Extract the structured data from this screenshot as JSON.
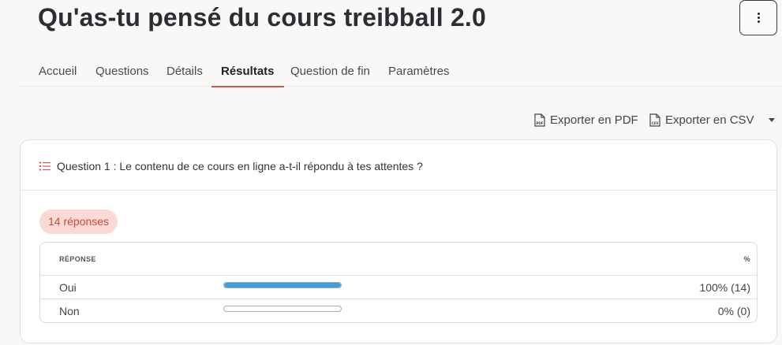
{
  "page": {
    "title": "Qu'as-tu pensé du cours treibball 2.0"
  },
  "tabs": [
    {
      "label": "Accueil",
      "active": false
    },
    {
      "label": "Questions",
      "active": false
    },
    {
      "label": "Détails",
      "active": false
    },
    {
      "label": "Résultats",
      "active": true
    },
    {
      "label": "Question de fin",
      "active": false
    },
    {
      "label": "Paramètres",
      "active": false
    }
  ],
  "exports": {
    "pdf_label": "Exporter en PDF",
    "pdf_icon_text": "PDF",
    "csv_label": "Exporter en CSV",
    "csv_icon_text": "CSV"
  },
  "question": {
    "text": "Question 1 : Le contenu de ce cours en ligne a-t-il répondu à tes attentes ?",
    "responses_badge": "14 réponses",
    "table": {
      "col_response": "RÉPONSE",
      "col_percent": "%",
      "rows": [
        {
          "label": "Oui",
          "percent_text": "100% (14)",
          "fraction": 1.0
        },
        {
          "label": "Non",
          "percent_text": "0% (0)",
          "fraction": 0.0
        }
      ]
    }
  },
  "colors": {
    "accent": "#d4574a",
    "badge_bg": "#fbd9d4",
    "bar_fill": "#3aa1de"
  }
}
